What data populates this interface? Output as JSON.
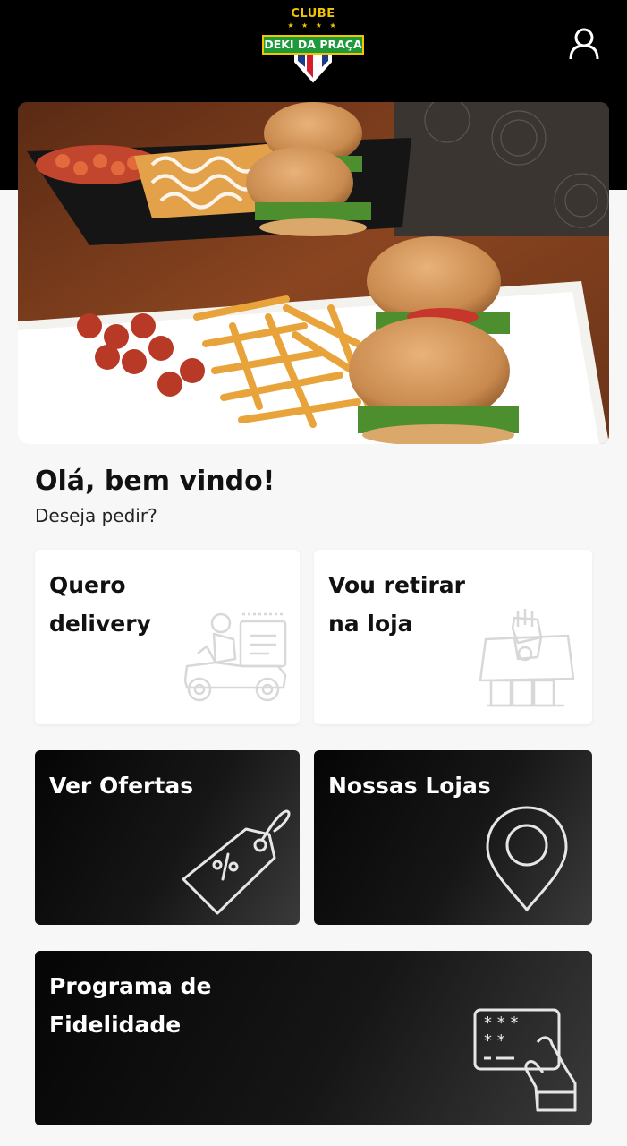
{
  "header": {
    "logo": {
      "top_text": "CLUBE",
      "stars": "★ ★ ★ ★",
      "band_text": "DEKI DA PRAÇA"
    },
    "user_icon": "user-icon"
  },
  "hero": {
    "image": "burgers-fries-sausage-platters"
  },
  "welcome": {
    "title": "Olá, bem vindo!",
    "subtitle": "Deseja pedir?"
  },
  "options": {
    "delivery": {
      "label": "Quero\ndelivery",
      "icon": "delivery-scooter-icon"
    },
    "pickup": {
      "label": "Vou retirar\nna loja",
      "icon": "store-pickup-icon"
    },
    "offers": {
      "label": "Ver Ofertas",
      "icon": "discount-tag-icon"
    },
    "stores": {
      "label": "Nossas Lojas",
      "icon": "map-pin-icon"
    },
    "loyalty": {
      "label": "Programa de\nFidelidade",
      "icon": "loyalty-card-icon"
    }
  },
  "colors": {
    "header_bg": "#000000",
    "background": "#f7f7f7",
    "card_light": "#ffffff",
    "card_dark": "#111111",
    "logo_green": "#1f9a3a",
    "logo_yellow": "#f2c500",
    "logo_red": "#d21f2b",
    "logo_blue": "#1e3a8a"
  }
}
